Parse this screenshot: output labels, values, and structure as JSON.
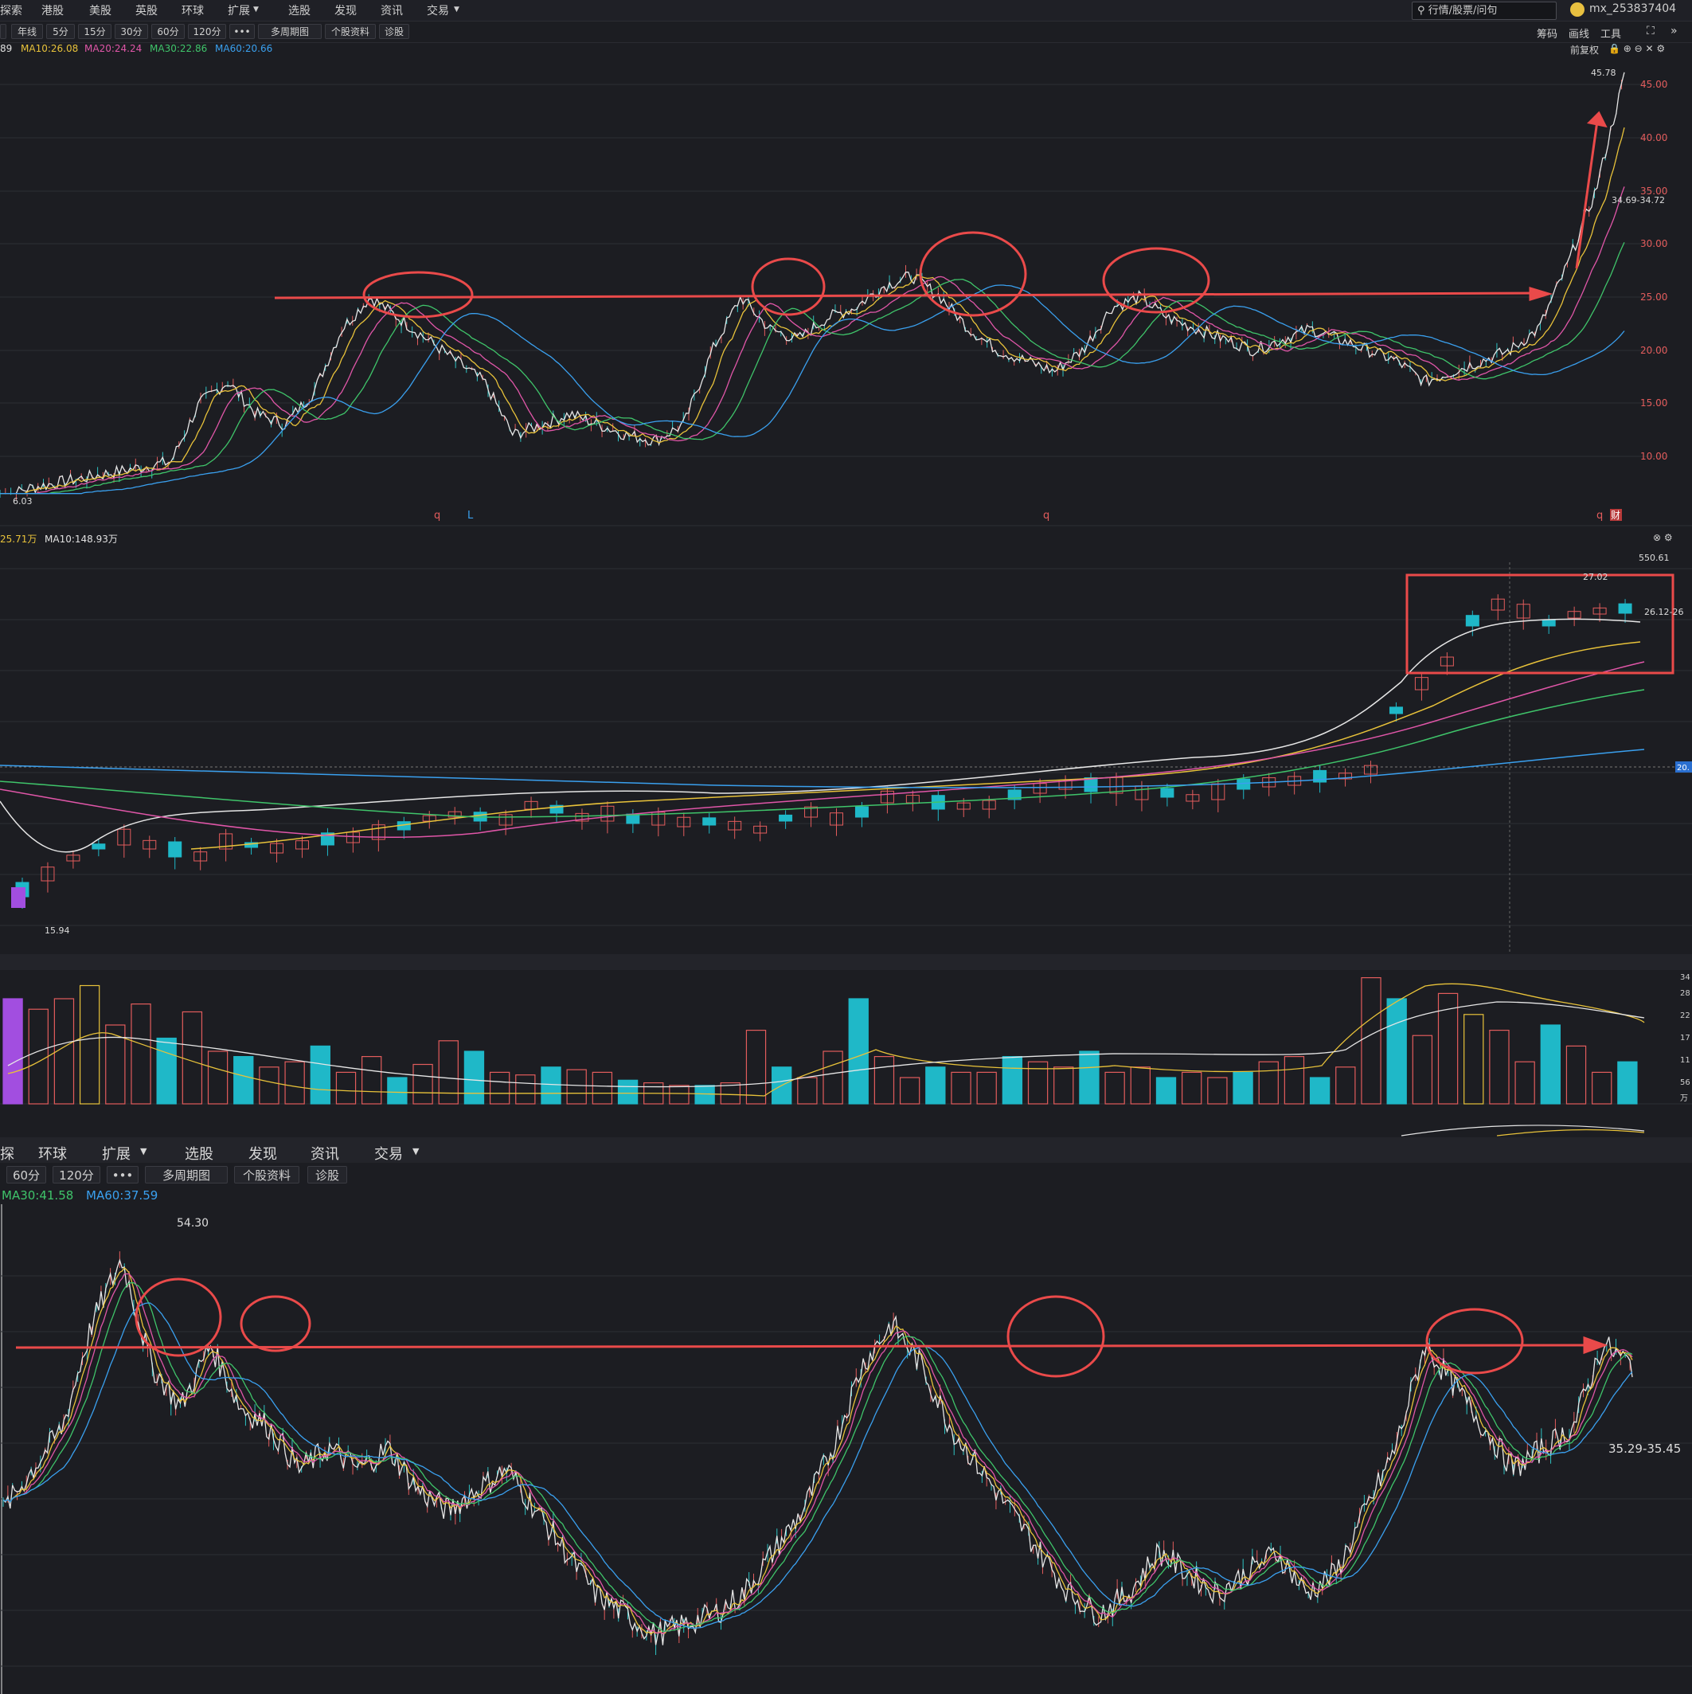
{
  "top_menu": [
    "探索",
    "港股",
    "美股",
    "英股",
    "环球",
    "扩展",
    "选股",
    "发现",
    "资讯",
    "交易"
  ],
  "search": {
    "placeholder": "行情/股票/问句"
  },
  "user": {
    "name": "mx_253837404"
  },
  "toolbar": {
    "periods": [
      "年线",
      "5分",
      "15分",
      "30分",
      "60分",
      "120分",
      "•••",
      "多周期图",
      "个股资料",
      "诊股"
    ],
    "right": [
      "筹码",
      "画线",
      "工具",
      "前复权"
    ]
  },
  "chart1": {
    "ma_labels": [
      "89",
      "MA10:26.08",
      "MA20:24.24",
      "MA30:22.86",
      "MA60:20.66"
    ],
    "price_labels": [
      "45.00",
      "40.00",
      "35.00",
      "30.00",
      "25.00",
      "20.00",
      "15.00",
      "10.00"
    ],
    "high_label": "45.78",
    "low_label": "6.03",
    "range_label": "34.69-34.72",
    "markers": [
      "q",
      "L",
      "q",
      "q",
      "财"
    ]
  },
  "chart2": {
    "ma_labels": [
      "25.71万",
      "MA10:148.93万"
    ],
    "top_label": "550.61",
    "low_label": "15.94",
    "high_label": "27.02",
    "range_label": "26.12-26",
    "right_tag": "20."
  },
  "volume": {
    "labels": [
      "34",
      "28",
      "22",
      "17",
      "11",
      "56",
      "万"
    ]
  },
  "bottom_menu": [
    "探",
    "环球",
    "扩展",
    "选股",
    "发现",
    "资讯",
    "交易"
  ],
  "bottom_toolbar": [
    "60分",
    "120分",
    "•••",
    "多周期图",
    "个股资料",
    "诊股"
  ],
  "chart3": {
    "ma_labels": [
      "MA30:41.58",
      "MA60:37.59"
    ],
    "high_label": "54.30",
    "range_label": "35.29-35.45"
  },
  "chart_data": [
    {
      "type": "line",
      "title": "",
      "series": [
        {
          "name": "",
          "values": [
            6.03,
            7,
            7.5,
            8,
            8.5,
            9,
            9.5,
            15,
            17,
            14,
            13,
            16,
            22,
            25,
            23,
            21,
            19,
            17,
            12,
            13,
            14,
            13,
            12,
            11.5,
            13,
            20,
            25,
            22,
            21,
            23,
            24,
            26,
            27,
            25,
            22,
            20,
            19,
            18,
            20,
            24,
            25,
            23,
            22,
            21,
            20,
            21,
            22,
            21,
            20,
            19,
            17,
            18,
            19,
            20,
            22,
            28,
            35,
            45.78
          ]
        }
      ],
      "ylim": [
        6,
        46
      ]
    },
    {
      "type": "bar",
      "title": "",
      "series": [
        {
          "name": "",
          "values": [
            40,
            36,
            40,
            45,
            30,
            38,
            25,
            35,
            20,
            18,
            14,
            16,
            22,
            12,
            18,
            10,
            15,
            24,
            20,
            12,
            11,
            14,
            13,
            12,
            9,
            8,
            7,
            7,
            8,
            28,
            14,
            10,
            20,
            40,
            18,
            10,
            14,
            12,
            12,
            18,
            16,
            14,
            20,
            12,
            14,
            10,
            12,
            10,
            12,
            16,
            18,
            10,
            14,
            48,
            40,
            26,
            42,
            34,
            28,
            16,
            30,
            22,
            12,
            16
          ]
        }
      ]
    },
    {
      "type": "line",
      "title": "",
      "series": [
        {
          "name": "",
          "values": [
            30,
            34,
            38,
            48,
            54.3,
            44,
            40,
            46,
            40,
            38,
            34,
            36,
            34,
            36,
            32,
            30,
            32,
            34,
            30,
            26,
            22,
            20,
            18,
            19,
            20,
            22,
            26,
            30,
            36,
            44,
            48,
            44,
            38,
            34,
            30,
            26,
            22,
            20,
            22,
            26,
            24,
            22,
            24,
            26,
            22,
            24,
            30,
            36,
            46,
            42,
            38,
            34,
            36,
            38,
            46,
            44
          ]
        }
      ],
      "ylim": [
        15,
        58
      ]
    }
  ]
}
